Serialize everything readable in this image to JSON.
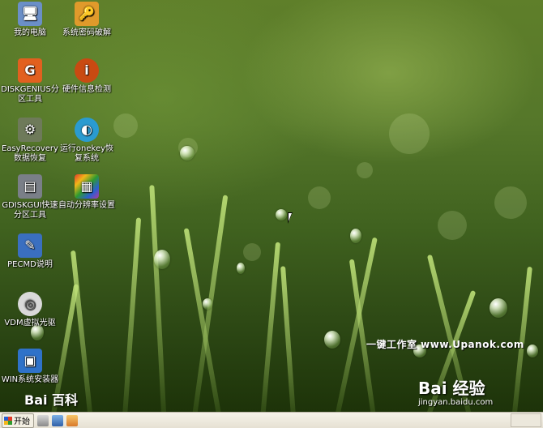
{
  "desktop": {
    "icons": [
      {
        "label": "我的电脑",
        "glyph": "🖥",
        "color": "#6b8fc7"
      },
      {
        "label": "系统密码破解",
        "glyph": "🔑",
        "color": "#e09a2b"
      },
      {
        "label": "DISKGENIUS分区工具",
        "glyph": "G",
        "color": "#e2601f"
      },
      {
        "label": "硬件信息检测",
        "glyph": "i",
        "color": "#c94a12"
      },
      {
        "label": "EasyRecovery数据恢复",
        "glyph": "⚙",
        "color": "#6e7a5a"
      },
      {
        "label": "运行onekey恢复系统",
        "glyph": "◐",
        "color": "#2a9bd0"
      },
      {
        "label": "GDISKGUI快速分区工具",
        "glyph": "▤",
        "color": "#7a7f88"
      },
      {
        "label": "自动分辨率设置",
        "glyph": "▦",
        "color": "#b03aa0"
      },
      {
        "label": "PECMD说明",
        "glyph": "✎",
        "color": "#3a6fc0"
      },
      {
        "label": "VDM虚拟光驱",
        "glyph": "◎",
        "color": "#c9c9c9"
      },
      {
        "label": "WIN系统安装器",
        "glyph": "▣",
        "color": "#2f72c9"
      }
    ],
    "watermark_site": "一键工作室  www.Upanok.com",
    "baidu_left": "Bai 百科",
    "baidu_right": "Bai 经验",
    "baidu_url": "jingyan.baidu.com"
  },
  "taskbar": {
    "start_label": "开始",
    "quick_icons": [
      "drive-icon",
      "explorer-icon",
      "folder-icon"
    ]
  }
}
